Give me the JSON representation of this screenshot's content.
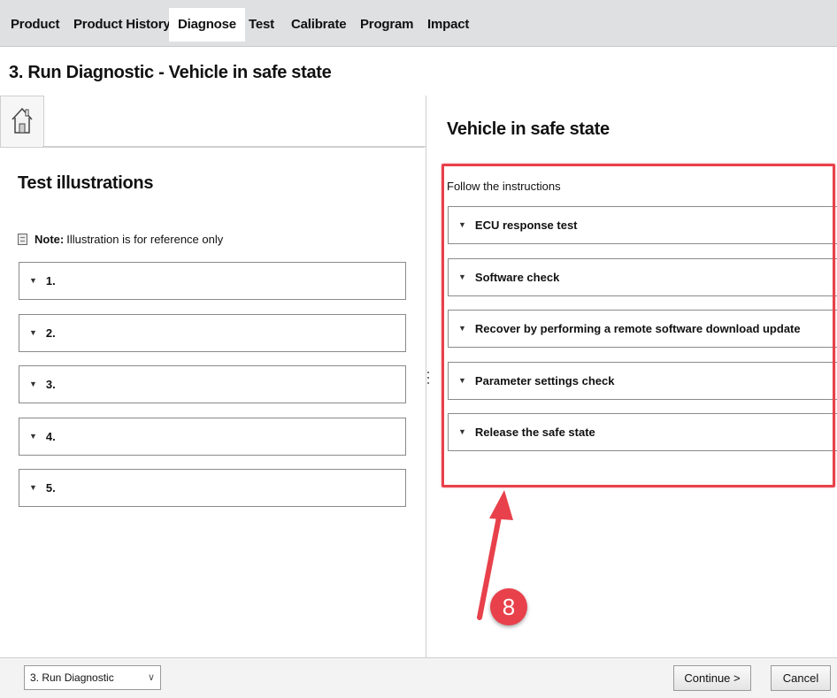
{
  "nav": {
    "items": [
      "Product",
      "Product History",
      "Diagnose",
      "Test",
      "Calibrate",
      "Program",
      "Impact"
    ],
    "active": "Diagnose"
  },
  "page_title": "3. Run Diagnostic - Vehicle in safe state",
  "left": {
    "home_icon": "home-icon",
    "section_title": "Test illustrations",
    "note_label": "Note:",
    "note_text": "Illustration is for reference only",
    "items": [
      "1.",
      "2.",
      "3.",
      "4.",
      "5."
    ]
  },
  "right": {
    "title": "Vehicle in safe state",
    "follow_text": "Follow the instructions",
    "items": [
      "ECU response test",
      "Software check",
      "Recover by performing a remote software download update",
      "Parameter settings check",
      "Release the safe state"
    ]
  },
  "annotation": {
    "badge": "8",
    "color": "#e8414b"
  },
  "bottom": {
    "step_select": "3. Run Diagnostic",
    "continue_label": "Continue >",
    "cancel_label": "Cancel"
  }
}
